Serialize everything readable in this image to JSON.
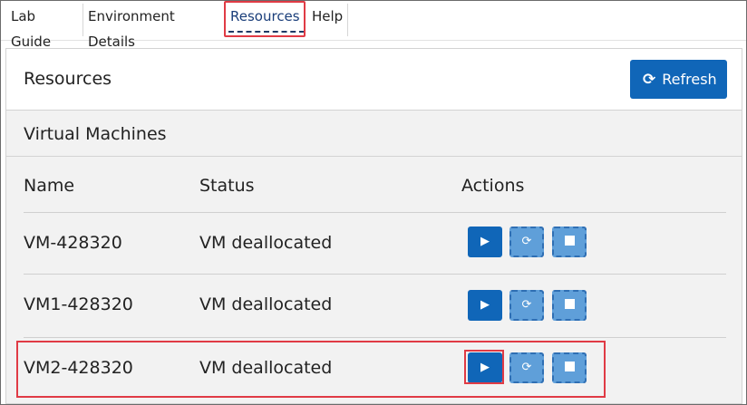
{
  "tabs": [
    {
      "label": "Lab Guide"
    },
    {
      "label": "Environment Details"
    },
    {
      "label": "Resources",
      "active": true
    },
    {
      "label": "Help"
    }
  ],
  "panel": {
    "title": "Resources",
    "refresh_label": "Refresh",
    "refresh_icon": "refresh-icon"
  },
  "section": {
    "title": "Virtual Machines"
  },
  "table": {
    "headers": {
      "name": "Name",
      "status": "Status",
      "actions": "Actions"
    },
    "rows": [
      {
        "name": "VM-428320",
        "status": "VM deallocated"
      },
      {
        "name": "VM1-428320",
        "status": "VM deallocated"
      },
      {
        "name": "VM2-428320",
        "status": "VM deallocated"
      }
    ]
  },
  "colors": {
    "primary": "#1066b8",
    "highlight": "#e03b45"
  }
}
